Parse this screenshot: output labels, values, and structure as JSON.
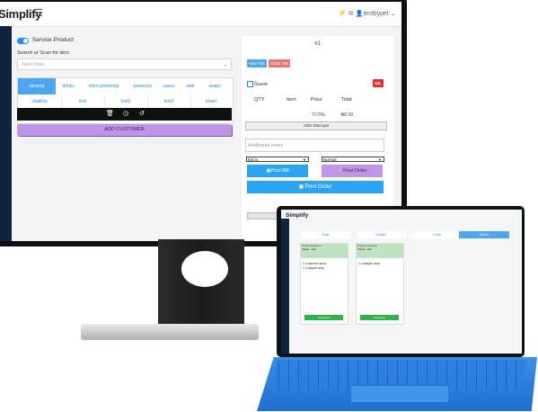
{
  "app": {
    "brand": "Simplify",
    "user": "testbypet",
    "menu_icon": "hamburger-icon"
  },
  "left": {
    "toggle_label": "Service Product",
    "search_label": "Search or Scan for item",
    "search_placeholder": "Select Item",
    "categories": [
      "deserts",
      "drinks",
      "intercontinental",
      "pasteries",
      "sauce",
      "side",
      "wraps"
    ],
    "subitems": [
      "swallow",
      "test",
      "test2",
      "test3",
      "towel"
    ],
    "toolbar_icons": [
      "trash-icon",
      "timer-icon",
      "undo-icon"
    ],
    "add_customer": "ADD CUSTOMER"
  },
  "order": {
    "number": "#1",
    "tab_new": "New Tab",
    "tab_close": "Close Tab",
    "guest": "Guest",
    "nil": "NIL",
    "headers": [
      "QTY",
      "Item",
      "Price",
      "Total"
    ],
    "total_label": "TOTAL",
    "total_value": "₦0.00",
    "add_discount": "ADD Discount",
    "notes_placeholder": "Additional notes",
    "dine_mode": "Eat in",
    "priority": "Normal",
    "print_bill": "Print Bill",
    "post_order": "Post Order",
    "print_order": "Print Order"
  },
  "tablet": {
    "brand": "Simplify",
    "columns": [
      "Total",
      "Kitchen",
      "Done",
      "Others"
    ],
    "cards": [
      {
        "title": "Guest Customer",
        "sub": "Waiter: staff",
        "lines": [
          "1 x cayenne sauce",
          "1 x plaigain wrap"
        ],
        "button": "Delivered"
      },
      {
        "title": "Guest Customer",
        "sub": "Waiter: staff",
        "lines": [
          "1 x plaigain wrap"
        ],
        "button": "Delivered"
      }
    ]
  }
}
